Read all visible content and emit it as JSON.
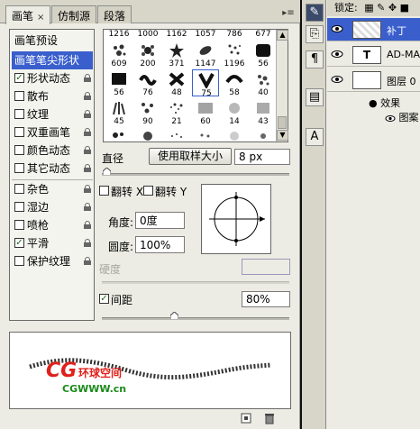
{
  "tabs": [
    {
      "label": "画笔",
      "close": "×"
    },
    {
      "label": "仿制源"
    },
    {
      "label": "段落"
    }
  ],
  "panel_menu": "▸≡",
  "sidebar": {
    "items": [
      {
        "label": "画笔预设",
        "checkbox": false,
        "lock": false,
        "selected": false
      },
      {
        "label": "画笔笔尖形状",
        "checkbox": false,
        "lock": false,
        "selected": true
      },
      {
        "label": "形状动态",
        "checkbox": true,
        "checked": true,
        "lock": true
      },
      {
        "label": "散布",
        "checkbox": true,
        "checked": false,
        "lock": true
      },
      {
        "label": "纹理",
        "checkbox": true,
        "checked": false,
        "lock": true
      },
      {
        "label": "双重画笔",
        "checkbox": true,
        "checked": false,
        "lock": true
      },
      {
        "label": "颜色动态",
        "checkbox": true,
        "checked": false,
        "lock": true
      },
      {
        "label": "其它动态",
        "checkbox": true,
        "checked": false,
        "lock": true
      },
      {
        "label": "杂色",
        "checkbox": true,
        "checked": false,
        "lock": true
      },
      {
        "label": "湿边",
        "checkbox": true,
        "checked": false,
        "lock": true
      },
      {
        "label": "喷枪",
        "checkbox": true,
        "checked": false,
        "lock": true
      },
      {
        "label": "平滑",
        "checkbox": true,
        "checked": true,
        "lock": true
      },
      {
        "label": "保护纹理",
        "checkbox": true,
        "checked": false,
        "lock": true
      }
    ]
  },
  "brush_tips": {
    "top_row": [
      "1216",
      "1000",
      "1162",
      "1057",
      "786",
      "677"
    ],
    "rows": [
      [
        "609",
        "200",
        "371",
        "1147",
        "1196",
        "56"
      ],
      [
        "56",
        "76",
        "48",
        "75",
        "58",
        "40"
      ],
      [
        "45",
        "90",
        "21",
        "60",
        "14",
        "43"
      ],
      [
        "",
        "",
        "",
        "",
        "",
        ""
      ]
    ]
  },
  "diameter": {
    "label": "直径",
    "button": "使用取样大小",
    "value": "8 px",
    "slider_fraction": 0.05
  },
  "flip": {
    "x_label": "翻转 X",
    "y_label": "翻转 Y"
  },
  "angle": {
    "label": "角度:",
    "value": "0度"
  },
  "roundness": {
    "label": "圆度:",
    "value": "100%"
  },
  "hardness": {
    "label": "硬度",
    "value": ""
  },
  "spacing": {
    "label": "间距",
    "checked": true,
    "value": "80%",
    "slider_fraction": 0.23
  },
  "preview": {
    "watermark_main": "CG",
    "watermark_sub": "环球空间",
    "watermark_url": "CGWWW.cn"
  },
  "layers": {
    "lock_label": "锁定:",
    "items": [
      {
        "name": "补丁",
        "selected": true,
        "thumb": ""
      },
      {
        "name": "AD-MAG",
        "selected": false,
        "thumb": "T"
      },
      {
        "name": "图层 0",
        "selected": false,
        "thumb": ""
      },
      {
        "name": "效果",
        "selected": false,
        "thumb": ""
      },
      {
        "name": "图案",
        "selected": false,
        "thumb": ""
      }
    ]
  },
  "colors": {
    "selection": "#3a5fcd",
    "check": "#1a6a1a"
  }
}
